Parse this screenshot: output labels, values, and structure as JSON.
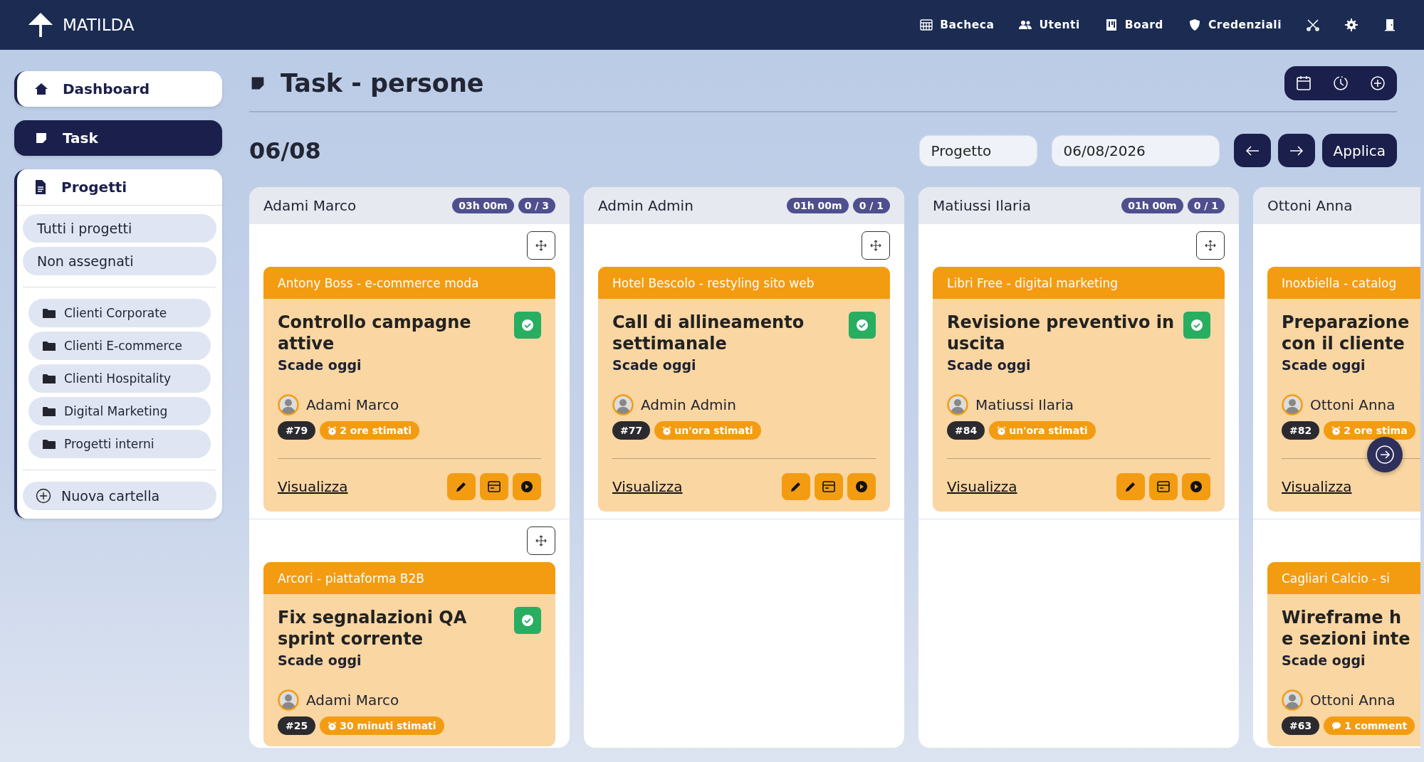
{
  "app": {
    "name": "MATILDA"
  },
  "nav": [
    {
      "kind": "calculator",
      "label": "Bacheca"
    },
    {
      "kind": "users",
      "label": "Utenti"
    },
    {
      "kind": "board",
      "label": "Board"
    },
    {
      "kind": "shield",
      "label": "Credenziali"
    },
    {
      "kind": "tools"
    },
    {
      "kind": "gear"
    },
    {
      "kind": "door"
    }
  ],
  "sidebar": {
    "items": [
      {
        "kind": "home",
        "label": "Dashboard",
        "selected": false
      },
      {
        "kind": "note",
        "label": "Task",
        "selected": true
      }
    ],
    "projects": {
      "title": "Progetti",
      "filters": [
        "Tutti i progetti",
        "Non assegnati"
      ],
      "folders": [
        "Clienti Corporate",
        "Clienti E-commerce",
        "Clienti Hospitality",
        "Digital Marketing",
        "Progetti interni"
      ],
      "new_folder": "Nuova cartella"
    }
  },
  "page": {
    "title": "Task - persone",
    "date": "06/08",
    "project_field": {
      "placeholder": "Progetto"
    },
    "date_field": {
      "value": "06/08/2026"
    },
    "apply": "Applica"
  },
  "columns": [
    {
      "name": "Adami Marco",
      "hours": "03h 00m",
      "count": "0 / 3",
      "tasks": [
        {
          "move_handle": true,
          "project": "Antony Boss - e-commerce moda",
          "title": "Controllo campagne attive",
          "due": "Scade oggi",
          "done": true,
          "assignee": "Adami Marco",
          "chips": [
            {
              "kind": "id",
              "text": "#79"
            },
            {
              "kind": "estimate",
              "text": "2 ore stimati"
            }
          ],
          "link": "Visualizza",
          "actions": true
        },
        {
          "move_handle": true,
          "project": "Arcori - piattaforma B2B",
          "title": "Fix segnalazioni QA sprint corrente",
          "due": "Scade oggi",
          "done": true,
          "assignee": "Adami Marco",
          "chips": [
            {
              "kind": "id",
              "text": "#25"
            },
            {
              "kind": "estimate",
              "text": "30 minuti stimati"
            }
          ],
          "actions": false
        }
      ]
    },
    {
      "name": "Admin Admin",
      "hours": "01h 00m",
      "count": "0 / 1",
      "tasks": [
        {
          "move_handle": true,
          "project": "Hotel Bescolo - restyling sito web",
          "title": "Call di allineamento settimanale",
          "due": "Scade oggi",
          "done": true,
          "assignee": "Admin Admin",
          "chips": [
            {
              "kind": "id",
              "text": "#77"
            },
            {
              "kind": "estimate",
              "text": "un'ora stimati"
            }
          ],
          "link": "Visualizza",
          "actions": true
        }
      ]
    },
    {
      "name": "Matiussi Ilaria",
      "hours": "01h 00m",
      "count": "0 / 1",
      "tasks": [
        {
          "move_handle": true,
          "project": "Libri Free - digital marketing",
          "title": "Revisione preventivo in uscita",
          "due": "Scade oggi",
          "done": true,
          "assignee": "Matiussi Ilaria",
          "chips": [
            {
              "kind": "id",
              "text": "#84"
            },
            {
              "kind": "estimate",
              "text": "un'ora stimati"
            }
          ],
          "link": "Visualizza",
          "actions": true
        }
      ]
    },
    {
      "name": "Ottoni Anna",
      "tasks": [
        {
          "move_handle": false,
          "project": "Inoxbiella - catalog",
          "title": "Preparazione\ncon il cliente",
          "due": "Scade oggi",
          "assignee": "Ottoni Anna",
          "chips": [
            {
              "kind": "id",
              "text": "#82"
            },
            {
              "kind": "estimate",
              "text": "2 ore stima"
            }
          ],
          "link": "Visualizza",
          "actions": false
        },
        {
          "move_handle": false,
          "project": "Cagliari Calcio - si",
          "title": "Wireframe h\ne sezioni inte",
          "due": "Scade oggi",
          "assignee": "Ottoni Anna",
          "chips": [
            {
              "kind": "id",
              "text": "#63"
            },
            {
              "kind": "comment",
              "text": "1 comment"
            }
          ],
          "actions": false
        }
      ]
    }
  ]
}
